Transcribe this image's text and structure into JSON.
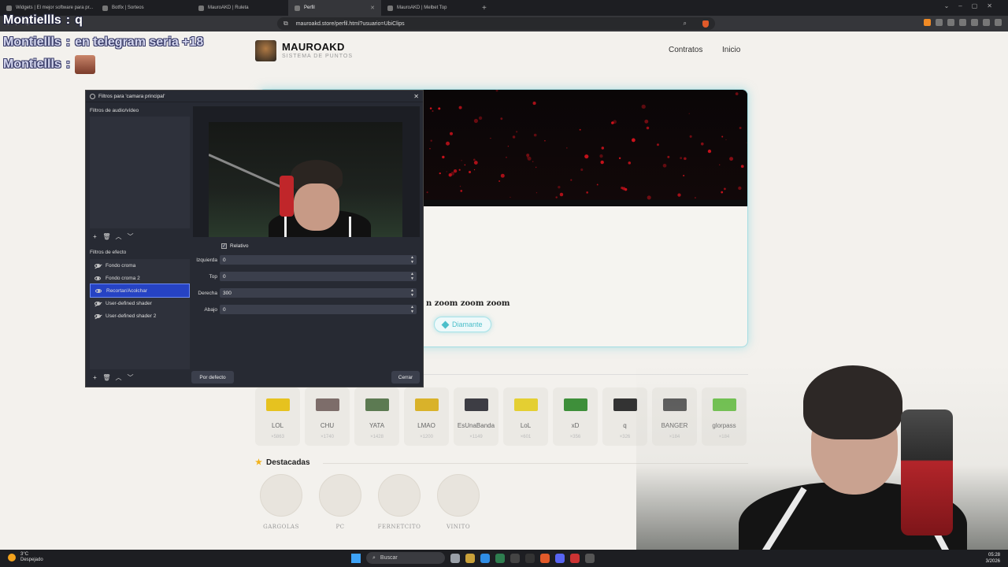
{
  "browser": {
    "tabs": [
      {
        "title": "Widgets | El mejor software para pr...",
        "active": false
      },
      {
        "title": "Botfix | Sorteos",
        "active": false
      },
      {
        "title": "MauroAKD | Ruleta",
        "active": false
      },
      {
        "title": "Perfil",
        "active": true
      },
      {
        "title": "MauroAKD | Melbet Top",
        "active": false
      }
    ],
    "url": "mauroakd.store/perfil.html?usuario=UbiClips"
  },
  "chat": {
    "messages": [
      {
        "user": "Montiellls",
        "text": "q"
      },
      {
        "user": "Montiellls",
        "text": "en telegram seria +18"
      },
      {
        "user": "Montiellls",
        "text": ""
      }
    ]
  },
  "site": {
    "brand": "MAUROAKD",
    "subtitle": "SISTEMA DE PUNTOS",
    "nav": [
      "Contratos",
      "Inicio"
    ],
    "profile": {
      "motto": "n zoom zoom zoom",
      "badge": "Diamante"
    },
    "emotes": [
      {
        "name": "LOL",
        "count": "×5863",
        "color": "#e6c21f"
      },
      {
        "name": "CHU",
        "count": "×1740",
        "color": "#7d6d6a"
      },
      {
        "name": "YATA",
        "count": "×1428",
        "color": "#5c7a52"
      },
      {
        "name": "LMAO",
        "count": "×1200",
        "color": "#d9b22a"
      },
      {
        "name": "EsUnaBanda",
        "count": "×1149",
        "color": "#3d3d44"
      },
      {
        "name": "LoL",
        "count": "×601",
        "color": "#e4cf32"
      },
      {
        "name": "xD",
        "count": "×356",
        "color": "#3e8f3a"
      },
      {
        "name": "q",
        "count": "×326",
        "color": "#333333"
      },
      {
        "name": "BANGER",
        "count": "×184",
        "color": "#555555"
      },
      {
        "name": "glorpass",
        "count": "×184",
        "color": "#6bbf4a"
      }
    ],
    "featured_title": "Destacadas",
    "featured": [
      "GARGOLAS",
      "PC",
      "FERNETCITO",
      "VINITO"
    ]
  },
  "obs": {
    "title": "Filtros para 'camara principal'",
    "audio_video_label": "Filtros de audio/vídeo",
    "effects_label": "Filtros de efecto",
    "effects": [
      {
        "name": "Fondo croma",
        "visible": false
      },
      {
        "name": "Fondo croma 2",
        "visible": true
      },
      {
        "name": "Recortar/Acolchar",
        "visible": true,
        "selected": true
      },
      {
        "name": "User-defined shader",
        "visible": false
      },
      {
        "name": "User-defined shader 2",
        "visible": false
      }
    ],
    "relativo_label": "Relativo",
    "fields": [
      {
        "label": "Izquierda",
        "value": "0"
      },
      {
        "label": "Top",
        "value": "0"
      },
      {
        "label": "Derecha",
        "value": "300"
      },
      {
        "label": "Abajo",
        "value": "0"
      }
    ],
    "default_btn": "Por defecto",
    "close_btn": "Cerrar"
  },
  "taskbar": {
    "temp": "3°C",
    "weather": "Despejado",
    "search": "Buscar",
    "time": "05:28",
    "date": "3/2026"
  }
}
